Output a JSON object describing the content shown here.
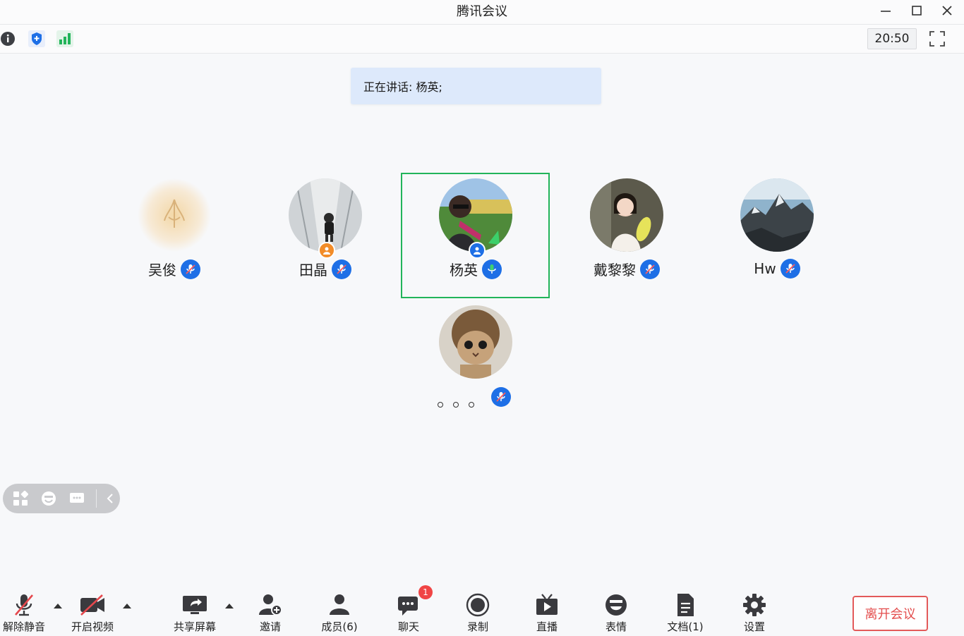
{
  "window": {
    "title": "腾讯会议"
  },
  "subbar": {
    "time": "20:50"
  },
  "speaking": {
    "text": "正在讲话: 杨英;"
  },
  "participants": [
    {
      "name": "吴俊",
      "mic": "mic-muted"
    },
    {
      "name": "田晶",
      "mic": "mic-muted"
    },
    {
      "name": "杨英",
      "mic": "mic-active",
      "active_speaker": true
    },
    {
      "name": "戴黎黎",
      "mic": "mic-muted"
    },
    {
      "name": "Hw",
      "mic": "mic-muted"
    },
    {
      "name": "。。。",
      "mic": "mic-muted"
    }
  ],
  "toolbar": {
    "unmute": "解除静音",
    "start_video": "开启视频",
    "share_screen": "共享屏幕",
    "invite": "邀请",
    "members": "成员(6)",
    "chat": "聊天",
    "chat_badge": "1",
    "record": "录制",
    "live": "直播",
    "emoji": "表情",
    "docs": "文档(1)",
    "settings": "设置",
    "leave": "离开会议"
  },
  "colors": {
    "accent_blue": "#1e6fe6",
    "active_green": "#22b45a",
    "leave_red": "#e34d4d",
    "badge_red": "#f04545"
  }
}
